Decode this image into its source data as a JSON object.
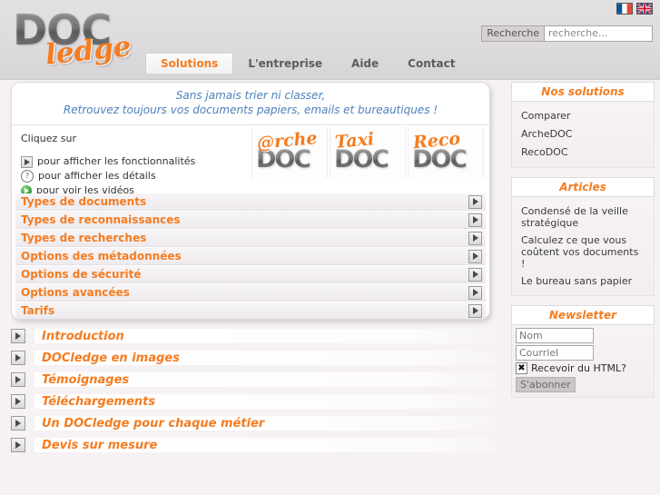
{
  "brand": {
    "logo_main": "DOC",
    "logo_script": "ledge"
  },
  "colors": {
    "accent_orange": "#f57c20",
    "tagline_blue": "#4d7fbb",
    "header_gray": "#dddbdd",
    "page_bg": "#f6f1f4"
  },
  "header": {
    "flags": [
      {
        "name": "flag-fr",
        "label": "Français"
      },
      {
        "name": "flag-en",
        "label": "English"
      }
    ],
    "search": {
      "button_label": "Recherche",
      "placeholder": "recherche...",
      "value": ""
    },
    "nav": [
      {
        "label": "Solutions",
        "active": true
      },
      {
        "label": "L'entreprise",
        "active": false
      },
      {
        "label": "Aide",
        "active": false
      },
      {
        "label": "Contact",
        "active": false
      }
    ]
  },
  "main": {
    "tagline_line1": "Sans jamais trier ni classer,",
    "tagline_line2": "Retrouvez toujours vos documents papiers, emails et bureautiques !",
    "legend_title": "Cliquez sur",
    "legend": [
      {
        "icon": "play-box-icon",
        "text": "pour afficher les fonctionnalités"
      },
      {
        "icon": "question-circle-icon",
        "text": "pour afficher les détails"
      },
      {
        "icon": "video-play-icon",
        "text": "pour voir les vidéos"
      }
    ],
    "products": [
      {
        "word": "@rche",
        "doc": "DOC"
      },
      {
        "word": "Taxi",
        "doc": "DOC"
      },
      {
        "word": "Reco",
        "doc": "DOC"
      }
    ],
    "accordion": [
      {
        "label": "Types de documents"
      },
      {
        "label": "Types de reconnaissances"
      },
      {
        "label": "Types de recherches"
      },
      {
        "label": "Options des métadonnées"
      },
      {
        "label": "Options de sécurité"
      },
      {
        "label": "Options avancées"
      },
      {
        "label": "Tarifs"
      }
    ]
  },
  "links": [
    {
      "label": "Introduction"
    },
    {
      "label": "DOCledge en images"
    },
    {
      "label": "Témoignages"
    },
    {
      "label": "Téléchargements"
    },
    {
      "label": "Un DOCledge pour chaque métier"
    },
    {
      "label": "Devis sur mesure"
    }
  ],
  "sidebar": {
    "solutions": {
      "title": "Nos solutions",
      "items": [
        {
          "label": "Comparer"
        },
        {
          "label": "ArcheDOC"
        },
        {
          "label": "RecoDOC"
        }
      ]
    },
    "articles": {
      "title": "Articles",
      "items": [
        {
          "label": "Condensé de la veille stratégique"
        },
        {
          "label": "Calculez ce que vous coûtent vos documents !"
        },
        {
          "label": "Le bureau sans papier"
        }
      ]
    },
    "newsletter": {
      "title": "Newsletter",
      "name_placeholder": "Nom",
      "name_value": "",
      "email_placeholder": "Courriel",
      "email_value": "",
      "html_checkbox_label": "Recevoir du HTML?",
      "html_checkbox_checked": true,
      "checkbox_glyph": "✖",
      "submit_label": "S'abonner"
    }
  }
}
